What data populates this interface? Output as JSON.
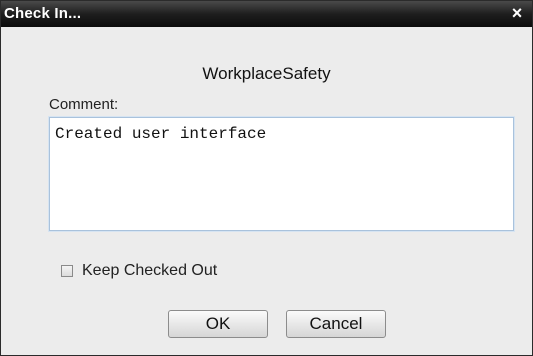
{
  "window": {
    "title": "Check In...",
    "close_glyph": "×"
  },
  "header": {
    "name": "WorkplaceSafety"
  },
  "comment": {
    "label": "Comment:",
    "value": "Created user interface"
  },
  "keep_checked_out": {
    "label": "Keep Checked Out",
    "checked": false
  },
  "buttons": {
    "ok_label": "OK",
    "cancel_label": "Cancel"
  }
}
